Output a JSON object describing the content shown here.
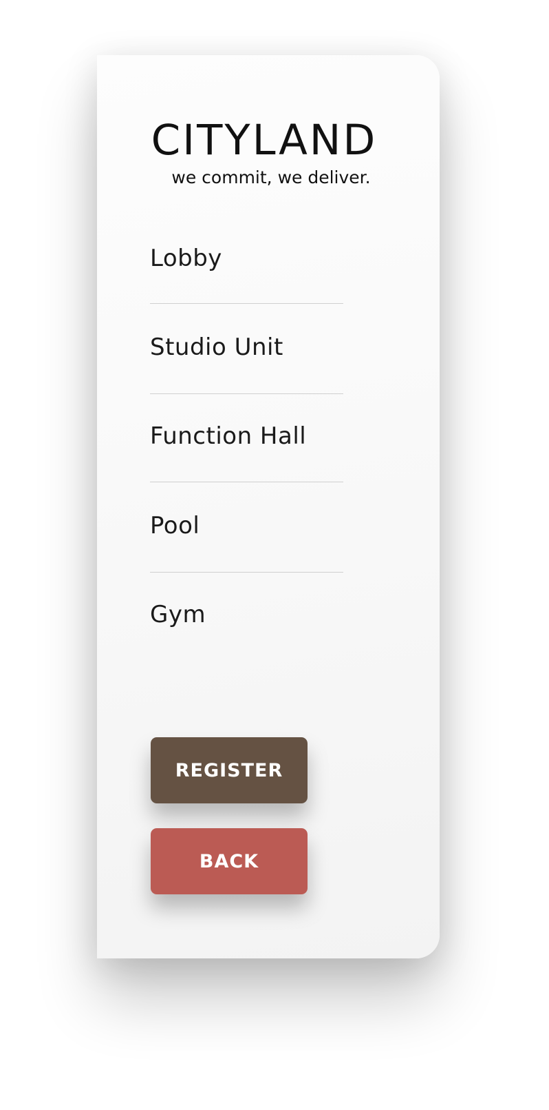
{
  "brand": {
    "name": "CITYLAND",
    "tagline": "we commit, we deliver."
  },
  "menu": {
    "items": [
      {
        "label": "Lobby"
      },
      {
        "label": "Studio Unit"
      },
      {
        "label": "Function Hall"
      },
      {
        "label": "Pool"
      },
      {
        "label": "Gym"
      }
    ]
  },
  "actions": {
    "register_label": "REGISTER",
    "back_label": "BACK"
  },
  "colors": {
    "register": "#655243",
    "back": "#bb5b54",
    "text": "#1a1a1a",
    "divider": "#cfcfcf"
  }
}
